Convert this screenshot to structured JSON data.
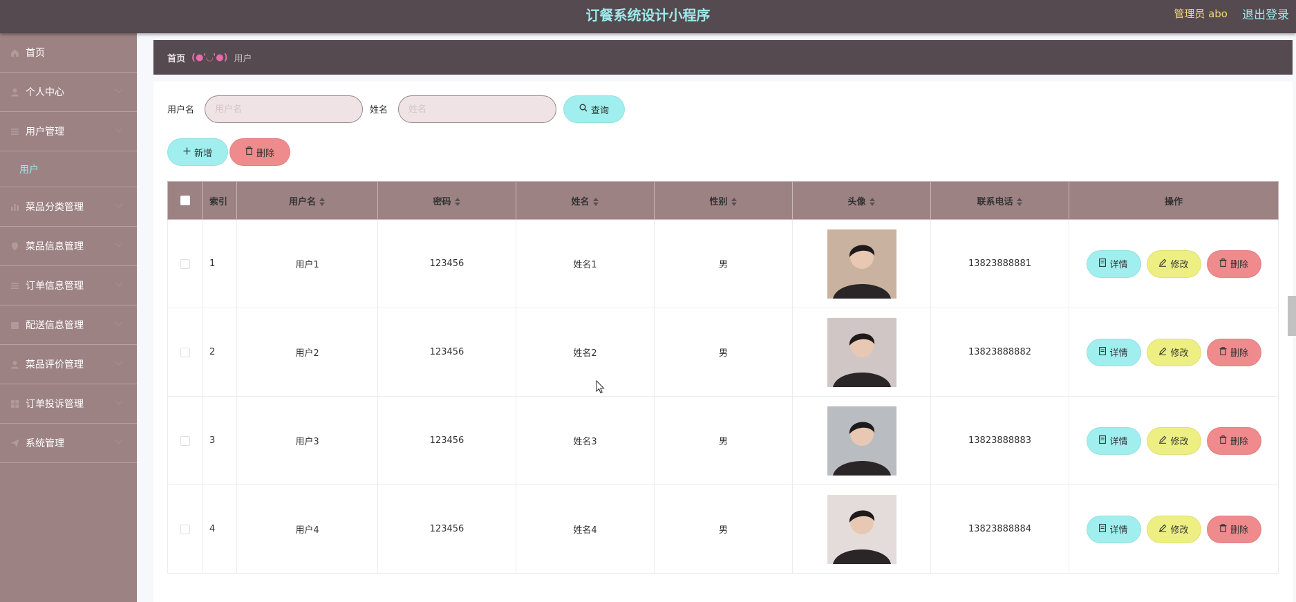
{
  "header": {
    "title": "订餐系统设计小程序",
    "user_label": "管理员 abo",
    "logout_label": "退出登录"
  },
  "sidebar": {
    "items": [
      {
        "label": "首页",
        "icon": "home-icon"
      },
      {
        "label": "个人中心",
        "icon": "user-icon"
      },
      {
        "label": "用户管理",
        "icon": "list-icon"
      },
      {
        "label": "菜品分类管理",
        "icon": "bar-chart-icon"
      },
      {
        "label": "菜品信息管理",
        "icon": "location-icon"
      },
      {
        "label": "订单信息管理",
        "icon": "list-icon"
      },
      {
        "label": "配送信息管理",
        "icon": "calendar-icon"
      },
      {
        "label": "菜品评价管理",
        "icon": "user-icon"
      },
      {
        "label": "订单投诉管理",
        "icon": "grid-icon"
      },
      {
        "label": "系统管理",
        "icon": "send-icon"
      }
    ],
    "sub_item": "用户"
  },
  "breadcrumb": {
    "home": "首页",
    "separator": "(●'◡'●)",
    "current": "用户"
  },
  "search": {
    "username_label": "用户名",
    "username_placeholder": "用户名",
    "name_label": "姓名",
    "name_placeholder": "姓名",
    "query_label": "查询"
  },
  "actions": {
    "add_label": "新增",
    "delete_label": "删除"
  },
  "table": {
    "columns": [
      "索引",
      "用户名",
      "密码",
      "姓名",
      "性别",
      "头像",
      "联系电话",
      "操作"
    ],
    "rows": [
      {
        "index": "1",
        "username": "用户1",
        "password": "123456",
        "name": "姓名1",
        "gender": "男",
        "phone": "13823888881"
      },
      {
        "index": "2",
        "username": "用户2",
        "password": "123456",
        "name": "姓名2",
        "gender": "男",
        "phone": "13823888882"
      },
      {
        "index": "3",
        "username": "用户3",
        "password": "123456",
        "name": "姓名3",
        "gender": "男",
        "phone": "13823888883"
      },
      {
        "index": "4",
        "username": "用户4",
        "password": "123456",
        "name": "姓名4",
        "gender": "男",
        "phone": "13823888884"
      }
    ],
    "row_actions": {
      "detail": "详情",
      "edit": "修改",
      "delete": "删除"
    }
  },
  "colors": {
    "topbar": "#544a4f",
    "accent_cyan": "#9ee9ea",
    "sidebar": "#9d8284",
    "button_red": "#ef8a8d",
    "button_yellow": "#edef82"
  }
}
